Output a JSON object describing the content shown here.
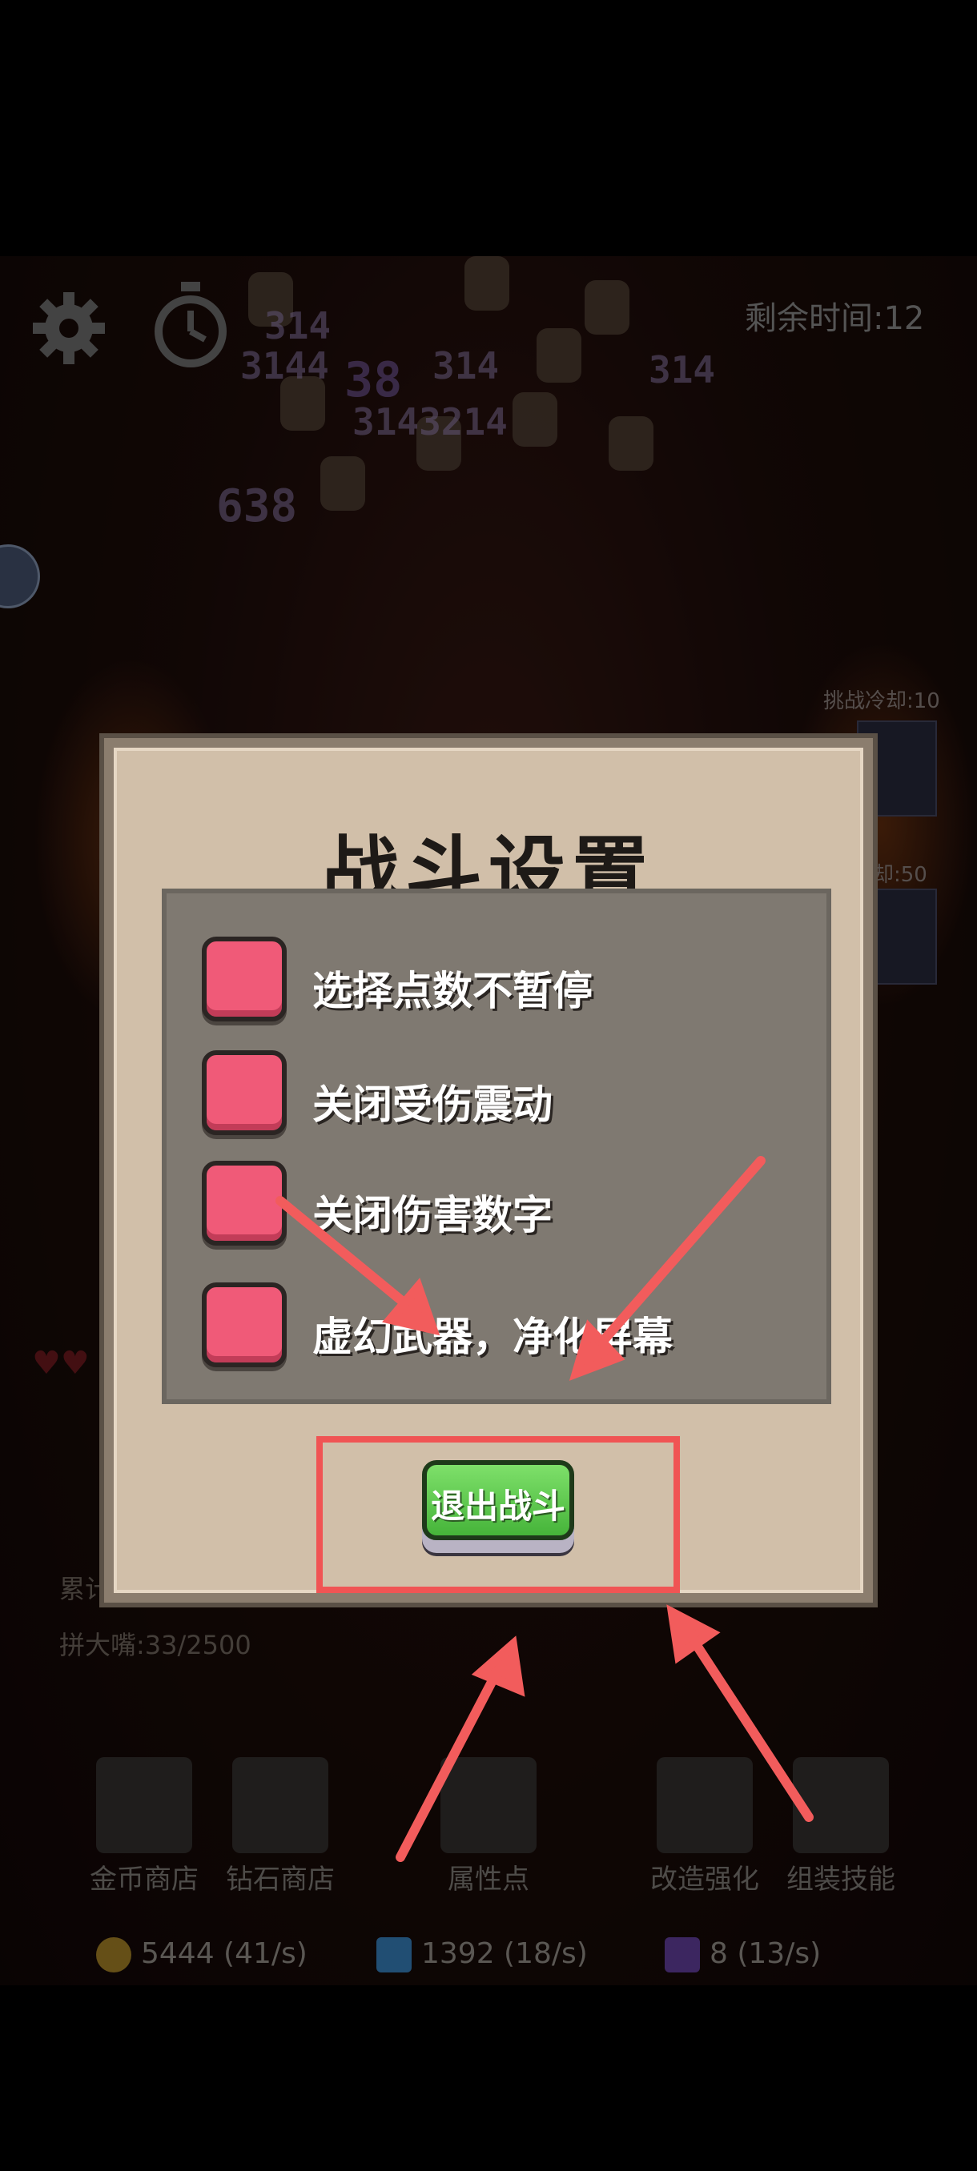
{
  "hud": {
    "remaining_time": "剩余时间:12",
    "damage_numbers": [
      "314",
      "3144",
      "38",
      "314",
      "3143214",
      "314",
      "638"
    ],
    "challenge_cooldown_1": "挑战冷却:10",
    "challenge_cooldown_2": "却:50"
  },
  "stats": {
    "line_1": "累计",
    "line_2": "拼大嘴:33/2500"
  },
  "dialog": {
    "title": "战斗设置",
    "options": [
      {
        "label": "选择点数不暂停",
        "checked": true
      },
      {
        "label": "关闭受伤震动",
        "checked": true
      },
      {
        "label": "关闭伤害数字",
        "checked": true
      },
      {
        "label": "虚幻武器，净化屏幕",
        "checked": true
      }
    ],
    "exit_button": "退出战斗"
  },
  "bottom_nav": {
    "items": [
      {
        "label": "金币商店",
        "icon": "gold-ingot-icon"
      },
      {
        "label": "钻石商店",
        "icon": "ice-cube-icon"
      },
      {
        "label": "属性点",
        "icon": "sword-icon"
      },
      {
        "label": "改造强化",
        "icon": "robot-icon"
      },
      {
        "label": "组装技能",
        "icon": "dice-icon"
      }
    ]
  },
  "currency": {
    "gold": "5444 (41/s)",
    "diamond": "1392 (18/s)",
    "gem": "8 (13/s)"
  },
  "colors": {
    "checkbox": "#f05a78",
    "exit_button": "#5ec64e",
    "annotation": "#f05454"
  }
}
